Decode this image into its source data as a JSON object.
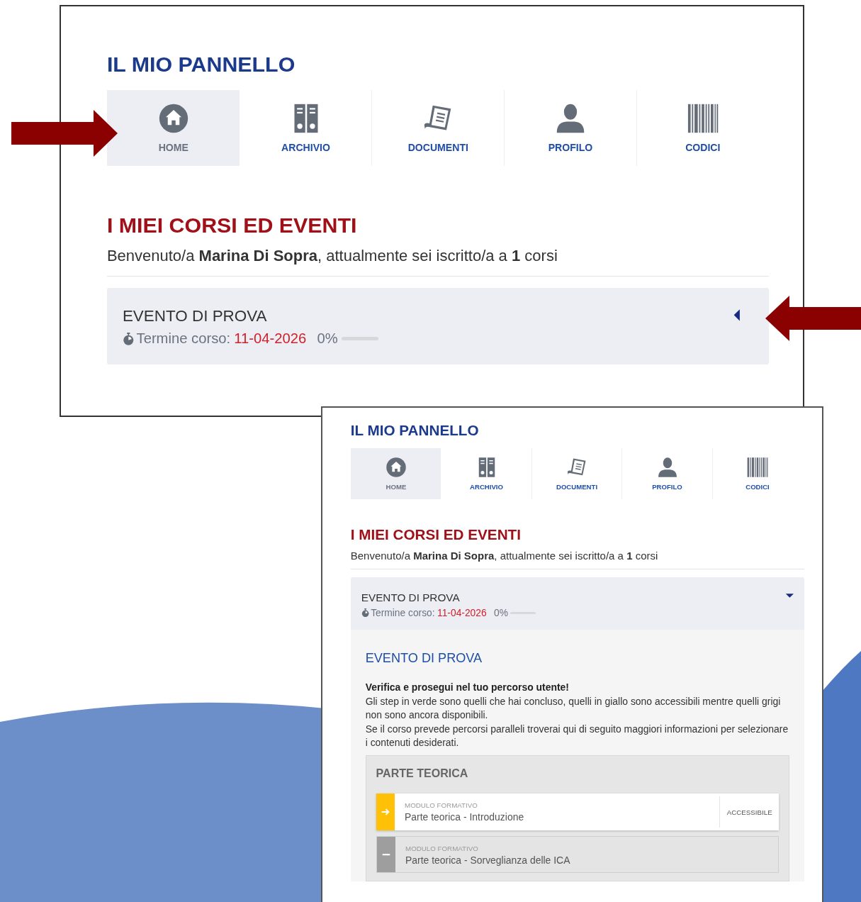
{
  "screenshots": [
    {
      "title": "IL MIO PANNELLO",
      "nav": [
        {
          "label": "HOME",
          "selected": true
        },
        {
          "label": "ARCHIVIO",
          "selected": false
        },
        {
          "label": "DOCUMENTI",
          "selected": false
        },
        {
          "label": "PROFILO",
          "selected": false
        },
        {
          "label": "CODICI",
          "selected": false
        }
      ],
      "section_title": "I MIEI CORSI ED EVENTI",
      "welcome": "Benvenuto/a **Marina Di Sopra**, attualmente sei iscritto/a a **1** corsi",
      "course": {
        "name": "EVENTO DI PROVA",
        "deadline_label": "Termine corso:",
        "deadline": "11-04-2026",
        "percent": "0%",
        "level": 0,
        "expanded": false
      }
    },
    {
      "title": "IL MIO PANNELLO",
      "nav": [
        {
          "label": "HOME",
          "selected": true
        },
        {
          "label": "ARCHIVIO",
          "selected": false
        },
        {
          "label": "DOCUMENTI",
          "selected": false
        },
        {
          "label": "PROFILO",
          "selected": false
        },
        {
          "label": "CODICI",
          "selected": false
        }
      ],
      "section_title": "I MIEI CORSI ED EVENTI",
      "welcome": "Benvenuto/a **Marina Di Sopra**, attualmente sei iscritto/a a **1** corsi",
      "course": {
        "name": "EVENTO DI PROVA",
        "deadline_label": "Termine corso:",
        "deadline": "11-04-2026",
        "percent": "0%",
        "level": 0,
        "expanded": true,
        "detail": {
          "title": "EVENTO DI PROVA",
          "intro_heading": "Verifica e prosegui nel tuo percorso utente!",
          "paragraphs": [
            "Gli step in verde sono quelli che hai concluso, quelli in giallo sono accessibili mentre quelli grigi non sono ancora disponibili.",
            "Se il corso prevede percorsi paralleli troverai qui di seguito maggiori informazioni per selezionare i contenuti desiderati."
          ],
          "section": {
            "title": "PARTE TEORICA",
            "modules": [
              {
                "kind": "accessible",
                "label": "MODULO FORMATIVO",
                "name": "Parte teorica - Introduzione",
                "status": "ACCESSIBILE"
              },
              {
                "kind": "locked",
                "label": "MODULO FORMATIVO",
                "name": "Parte teorica - Sorveglianza delle ICA"
              }
            ]
          }
        }
      }
    }
  ]
}
